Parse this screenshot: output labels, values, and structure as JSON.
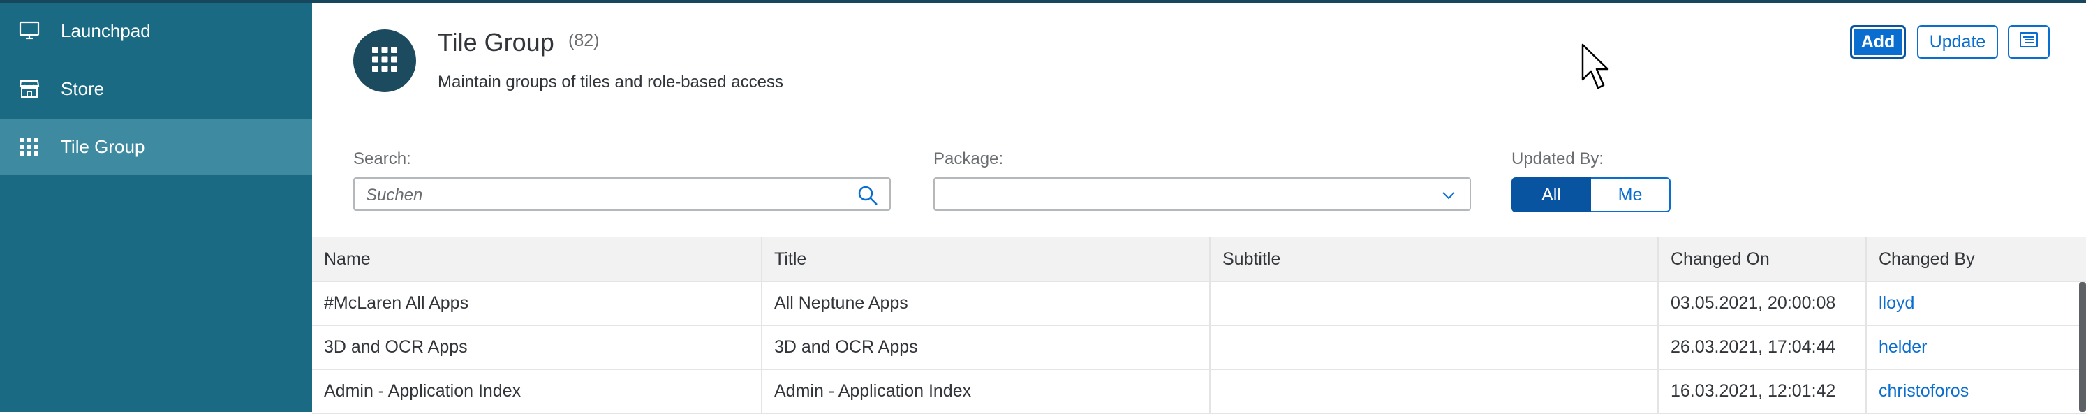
{
  "sidebar": {
    "items": [
      {
        "label": "Launchpad",
        "icon": "monitor-icon"
      },
      {
        "label": "Store",
        "icon": "store-icon"
      },
      {
        "label": "Tile Group",
        "icon": "grid-icon",
        "active": true
      }
    ]
  },
  "header": {
    "icon": "grid-icon",
    "title": "Tile Group",
    "count": "(82)",
    "subtitle": "Maintain groups of tiles and role-based access",
    "add_label": "Add",
    "update_label": "Update",
    "menu_icon": "table-settings-icon"
  },
  "filters": {
    "search_label": "Search:",
    "search_placeholder": "Suchen",
    "package_label": "Package:",
    "package_value": "",
    "updated_by_label": "Updated By:",
    "updated_by_options": [
      "All",
      "Me"
    ],
    "updated_by_selected": "All"
  },
  "table": {
    "columns": [
      "Name",
      "Title",
      "Subtitle",
      "Changed On",
      "Changed By"
    ],
    "rows": [
      {
        "name": "#McLaren All Apps",
        "title": "All Neptune Apps",
        "subtitle": "",
        "changed_on": "03.05.2021, 20:00:08",
        "changed_by": "lloyd"
      },
      {
        "name": "3D and OCR Apps",
        "title": "3D and OCR Apps",
        "subtitle": "",
        "changed_on": "26.03.2021, 17:04:44",
        "changed_by": "helder"
      },
      {
        "name": "Admin - Application Index",
        "title": "Admin - Application Index",
        "subtitle": "",
        "changed_on": "16.03.2021, 12:01:42",
        "changed_by": "christoforos"
      }
    ]
  },
  "colors": {
    "sidebar_bg": "#1a6a84",
    "sidebar_active": "#3d8aa1",
    "accent": "#0a6ed1",
    "header_icon_bg": "#1c4a5f"
  }
}
